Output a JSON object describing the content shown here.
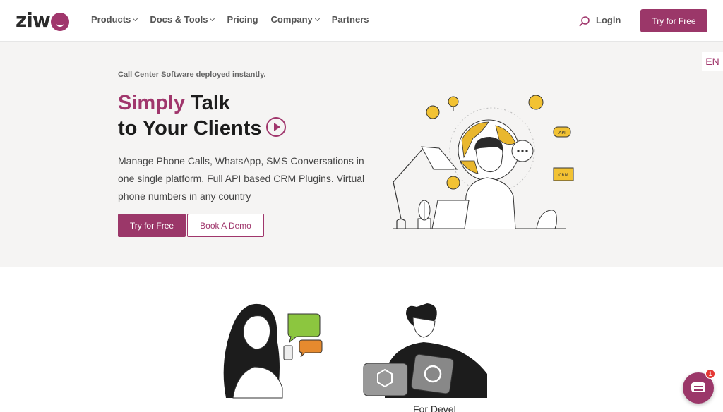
{
  "brand": {
    "logo_text": "ziw",
    "accent": "#9b3769"
  },
  "nav": {
    "items": [
      {
        "label": "Products",
        "dropdown": true
      },
      {
        "label": "Docs & Tools",
        "dropdown": true
      },
      {
        "label": "Pricing",
        "dropdown": false
      },
      {
        "label": "Company",
        "dropdown": true
      },
      {
        "label": "Partners",
        "dropdown": false
      }
    ],
    "login_label": "Login",
    "try_label": "Try for Free"
  },
  "lang": "EN",
  "hero": {
    "tagline": "Call Center Software deployed instantly.",
    "headline_accent": "Simply",
    "headline_rest1": " Talk",
    "headline_line2": "to Your Clients",
    "description": "Manage Phone Calls, WhatsApp, SMS Conversations in one single platform. Full API based CRM Plugins. Virtual phone numbers in any country",
    "primary_button": "Try for Free",
    "secondary_button": "Book A Demo",
    "illustration_labels": {
      "api": "API",
      "crm": "CRM"
    }
  },
  "lower": {
    "partial_text": "For Devel"
  },
  "chat": {
    "badge_count": "1"
  },
  "icons": [
    "search-icon",
    "play-icon",
    "chevron-down-icon",
    "chat-icon",
    "location-pin-icon",
    "whatsapp-icon",
    "phone-icon"
  ]
}
